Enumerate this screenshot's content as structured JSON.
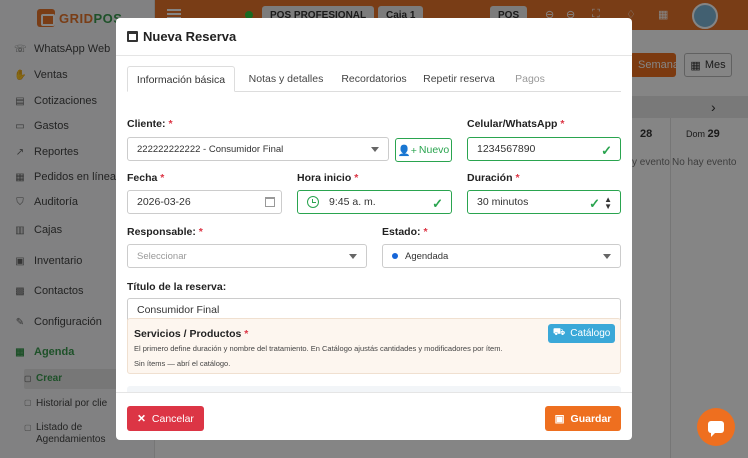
{
  "app": {
    "logo": "GRIDPOS",
    "topbar": {
      "pos_profile": "POS PROFESIONAL",
      "caja": "Caja 1",
      "pos_button": "POS"
    },
    "sidebar": {
      "items": [
        {
          "label": "WhatsApp Web",
          "icon": "whatsapp-icon"
        },
        {
          "label": "Ventas",
          "icon": "hand-icon"
        },
        {
          "label": "Cotizaciones",
          "icon": "document-icon"
        },
        {
          "label": "Gastos",
          "icon": "money-icon"
        },
        {
          "label": "Reportes",
          "icon": "chart-icon"
        },
        {
          "label": "Pedidos en línea",
          "icon": "cart-icon"
        },
        {
          "label": "Auditoría",
          "icon": "shield-icon"
        },
        {
          "label": "Cajas",
          "icon": "cash-register-icon"
        },
        {
          "label": "Inventario",
          "icon": "box-icon"
        },
        {
          "label": "Contactos",
          "icon": "contacts-icon"
        },
        {
          "label": "Configuración",
          "icon": "wrench-icon"
        },
        {
          "label": "Agenda",
          "icon": "calendar-icon"
        }
      ],
      "subitems": [
        "Crear",
        "Historial por clie",
        "Listado de Agendamientos"
      ]
    },
    "calendar": {
      "view_semana": "Semana",
      "view_mes": "Mes",
      "day1": "28",
      "day2_name": "Dom",
      "day2": "29",
      "empty1": "y evento",
      "empty2": "No hay evento"
    }
  },
  "modal": {
    "title": "Nueva Reserva",
    "tabs": [
      "Información básica",
      "Notas y detalles",
      "Recordatorios",
      "Repetir reserva",
      "Pagos"
    ],
    "cliente": {
      "label": "Cliente:",
      "value": "222222222222 - Consumidor Final"
    },
    "nuevo_button": "Nuevo",
    "celular": {
      "label": "Celular/WhatsApp",
      "value": "1234567890"
    },
    "fecha": {
      "label": "Fecha",
      "value": "2026-03-26"
    },
    "hora": {
      "label": "Hora inicio",
      "value": "9:45 a. m."
    },
    "duracion": {
      "label": "Duración",
      "value": "30 minutos"
    },
    "responsable": {
      "label": "Responsable:",
      "placeholder": "Seleccionar"
    },
    "estado": {
      "label": "Estado:",
      "value": "Agendada",
      "color": "#1565d8"
    },
    "titulo": {
      "label": "Título de la reserva:",
      "value": "Consumidor Final"
    },
    "servicios": {
      "title": "Servicios / Productos",
      "description": "El primero define duración y nombre del tratamiento. En Catálogo ajustás cantidades y modificadores por ítem.",
      "empty": "Sin ítems — abrí el catálogo.",
      "catalogo_button": "Catálogo"
    },
    "cancel_button": "Cancelar",
    "save_button": "Guardar"
  },
  "colors": {
    "accent": "#ee6f1f",
    "success": "#2aa44f",
    "danger": "#dc3545",
    "info": "#3aa8d8"
  }
}
